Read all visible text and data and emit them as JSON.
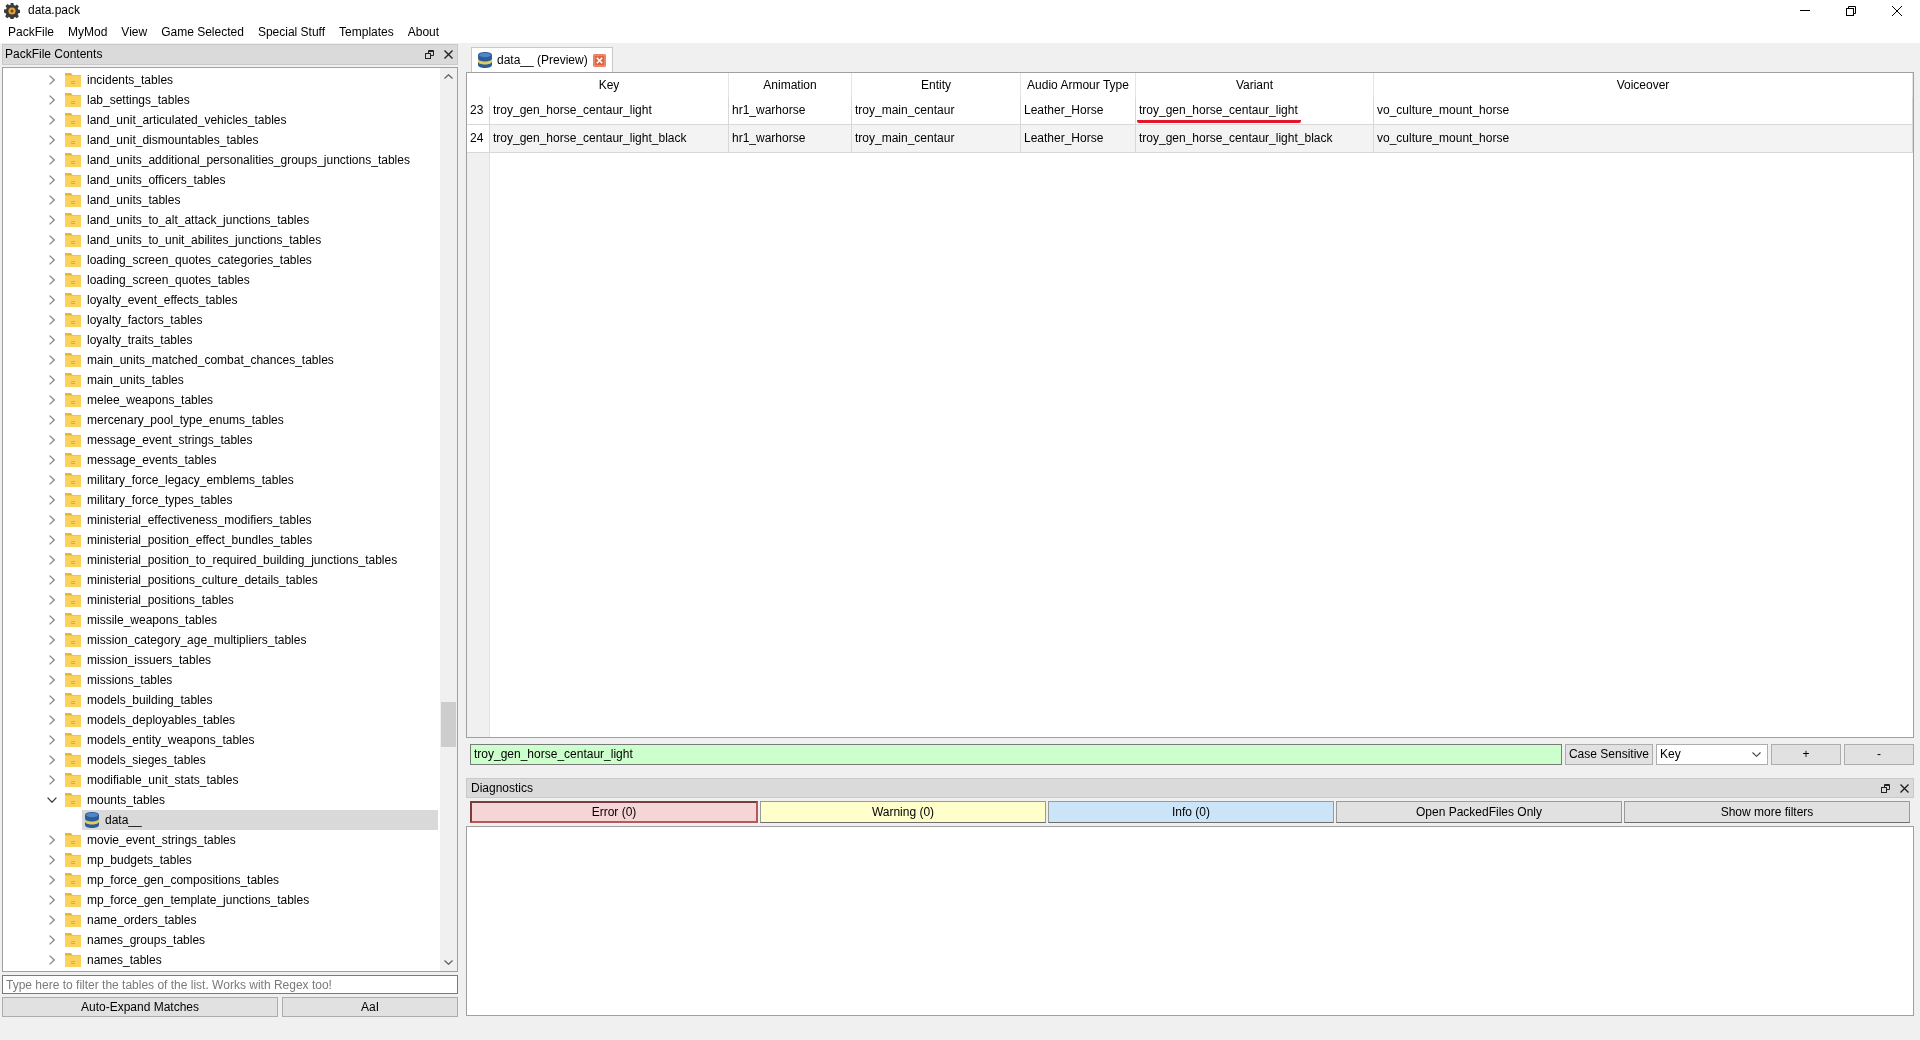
{
  "window": {
    "title": "data.pack"
  },
  "menu": [
    "PackFile",
    "MyMod",
    "View",
    "Game Selected",
    "Special Stuff",
    "Templates",
    "About"
  ],
  "packfile_panel": {
    "title": "PackFile Contents",
    "tree": [
      {
        "label": "incidents_tables",
        "kind": "folder",
        "expanded": false,
        "selected": false
      },
      {
        "label": "lab_settings_tables",
        "kind": "folder",
        "expanded": false,
        "selected": false
      },
      {
        "label": "land_unit_articulated_vehicles_tables",
        "kind": "folder",
        "expanded": false,
        "selected": false
      },
      {
        "label": "land_unit_dismountables_tables",
        "kind": "folder",
        "expanded": false,
        "selected": false
      },
      {
        "label": "land_units_additional_personalities_groups_junctions_tables",
        "kind": "folder",
        "expanded": false,
        "selected": false
      },
      {
        "label": "land_units_officers_tables",
        "kind": "folder",
        "expanded": false,
        "selected": false
      },
      {
        "label": "land_units_tables",
        "kind": "folder",
        "expanded": false,
        "selected": false
      },
      {
        "label": "land_units_to_alt_attack_junctions_tables",
        "kind": "folder",
        "expanded": false,
        "selected": false
      },
      {
        "label": "land_units_to_unit_abilites_junctions_tables",
        "kind": "folder",
        "expanded": false,
        "selected": false
      },
      {
        "label": "loading_screen_quotes_categories_tables",
        "kind": "folder",
        "expanded": false,
        "selected": false
      },
      {
        "label": "loading_screen_quotes_tables",
        "kind": "folder",
        "expanded": false,
        "selected": false
      },
      {
        "label": "loyalty_event_effects_tables",
        "kind": "folder",
        "expanded": false,
        "selected": false
      },
      {
        "label": "loyalty_factors_tables",
        "kind": "folder",
        "expanded": false,
        "selected": false
      },
      {
        "label": "loyalty_traits_tables",
        "kind": "folder",
        "expanded": false,
        "selected": false
      },
      {
        "label": "main_units_matched_combat_chances_tables",
        "kind": "folder",
        "expanded": false,
        "selected": false
      },
      {
        "label": "main_units_tables",
        "kind": "folder",
        "expanded": false,
        "selected": false
      },
      {
        "label": "melee_weapons_tables",
        "kind": "folder",
        "expanded": false,
        "selected": false
      },
      {
        "label": "mercenary_pool_type_enums_tables",
        "kind": "folder",
        "expanded": false,
        "selected": false
      },
      {
        "label": "message_event_strings_tables",
        "kind": "folder",
        "expanded": false,
        "selected": false
      },
      {
        "label": "message_events_tables",
        "kind": "folder",
        "expanded": false,
        "selected": false
      },
      {
        "label": "military_force_legacy_emblems_tables",
        "kind": "folder",
        "expanded": false,
        "selected": false
      },
      {
        "label": "military_force_types_tables",
        "kind": "folder",
        "expanded": false,
        "selected": false
      },
      {
        "label": "ministerial_effectiveness_modifiers_tables",
        "kind": "folder",
        "expanded": false,
        "selected": false
      },
      {
        "label": "ministerial_position_effect_bundles_tables",
        "kind": "folder",
        "expanded": false,
        "selected": false
      },
      {
        "label": "ministerial_position_to_required_building_junctions_tables",
        "kind": "folder",
        "expanded": false,
        "selected": false
      },
      {
        "label": "ministerial_positions_culture_details_tables",
        "kind": "folder",
        "expanded": false,
        "selected": false
      },
      {
        "label": "ministerial_positions_tables",
        "kind": "folder",
        "expanded": false,
        "selected": false
      },
      {
        "label": "missile_weapons_tables",
        "kind": "folder",
        "expanded": false,
        "selected": false
      },
      {
        "label": "mission_category_age_multipliers_tables",
        "kind": "folder",
        "expanded": false,
        "selected": false
      },
      {
        "label": "mission_issuers_tables",
        "kind": "folder",
        "expanded": false,
        "selected": false
      },
      {
        "label": "missions_tables",
        "kind": "folder",
        "expanded": false,
        "selected": false
      },
      {
        "label": "models_building_tables",
        "kind": "folder",
        "expanded": false,
        "selected": false
      },
      {
        "label": "models_deployables_tables",
        "kind": "folder",
        "expanded": false,
        "selected": false
      },
      {
        "label": "models_entity_weapons_tables",
        "kind": "folder",
        "expanded": false,
        "selected": false
      },
      {
        "label": "models_sieges_tables",
        "kind": "folder",
        "expanded": false,
        "selected": false
      },
      {
        "label": "modifiable_unit_stats_tables",
        "kind": "folder",
        "expanded": false,
        "selected": false
      },
      {
        "label": "mounts_tables",
        "kind": "folder",
        "expanded": true,
        "selected": false,
        "children": [
          {
            "label": "data__",
            "kind": "table",
            "selected": true
          }
        ]
      },
      {
        "label": "movie_event_strings_tables",
        "kind": "folder",
        "expanded": false,
        "selected": false
      },
      {
        "label": "mp_budgets_tables",
        "kind": "folder",
        "expanded": false,
        "selected": false
      },
      {
        "label": "mp_force_gen_compositions_tables",
        "kind": "folder",
        "expanded": false,
        "selected": false
      },
      {
        "label": "mp_force_gen_template_junctions_tables",
        "kind": "folder",
        "expanded": false,
        "selected": false
      },
      {
        "label": "name_orders_tables",
        "kind": "folder",
        "expanded": false,
        "selected": false
      },
      {
        "label": "names_groups_tables",
        "kind": "folder",
        "expanded": false,
        "selected": false
      },
      {
        "label": "names_tables",
        "kind": "folder",
        "expanded": false,
        "selected": false
      }
    ],
    "filter": {
      "placeholder": "Type here to filter the tables of the list. Works with Regex too!"
    },
    "buttons": [
      "Auto-Expand Matches",
      "AaI"
    ]
  },
  "tabs": [
    {
      "label": "data__ (Preview)",
      "selected": true
    }
  ],
  "table": {
    "columns": [
      "Key",
      "Animation",
      "Entity",
      "Audio Armour Type",
      "Variant",
      "Voiceover"
    ],
    "rows": [
      {
        "number": "23",
        "cells": [
          {
            "text": "troy_gen_horse_centaur_light",
            "underlined": false
          },
          {
            "text": "hr1_warhorse",
            "underlined": false
          },
          {
            "text": "troy_main_centaur",
            "underlined": false
          },
          {
            "text": "Leather_Horse",
            "underlined": false
          },
          {
            "text": "troy_gen_horse_centaur_light",
            "underlined": true
          },
          {
            "text": "vo_culture_mount_horse",
            "underlined": false
          }
        ]
      },
      {
        "number": "24",
        "cells": [
          {
            "text": "troy_gen_horse_centaur_light_black",
            "underlined": false
          },
          {
            "text": "hr1_warhorse",
            "underlined": false
          },
          {
            "text": "troy_main_centaur",
            "underlined": false
          },
          {
            "text": "Leather_Horse",
            "underlined": false
          },
          {
            "text": "troy_gen_horse_centaur_light_black",
            "underlined": false
          },
          {
            "text": "vo_culture_mount_horse",
            "underlined": false
          }
        ]
      }
    ]
  },
  "table_filter": {
    "value": "troy_gen_horse_centaur_light",
    "valid": true,
    "case_sensitive_button": "Case Sensitive",
    "column": "Key",
    "buttons": [
      "+",
      "-"
    ]
  },
  "diagnostics": {
    "title": "Diagnostics",
    "filters": [
      {
        "label": "Error (0)",
        "color": "#f5d5d5",
        "checked": true
      },
      {
        "label": "Warning (0)",
        "color": "#ffffcc",
        "checked": false
      },
      {
        "label": "Info (0)",
        "color": "#cce4f7",
        "checked": false
      },
      {
        "label": "Open PackedFiles Only",
        "color": "#e1e1e1",
        "checked": false
      },
      {
        "label": "Show more filters",
        "color": "#e1e1e1",
        "checked": false
      }
    ]
  }
}
